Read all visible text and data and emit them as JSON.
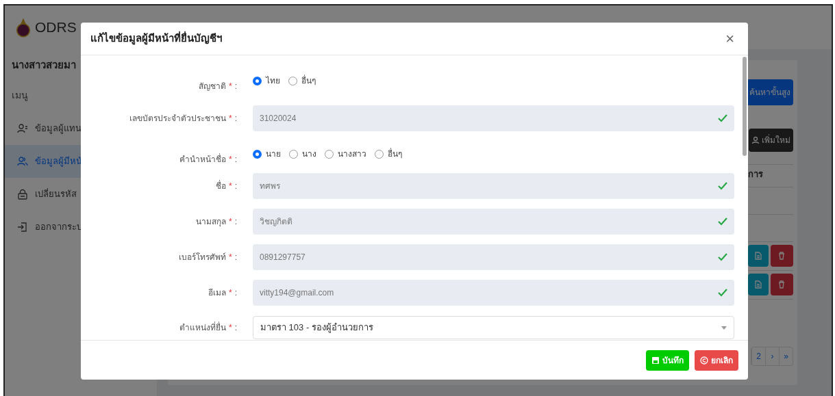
{
  "sidebar": {
    "logo_text": "ODRS",
    "user_name": "นางสาวสวยมา",
    "menu_label": "เมนู",
    "items": [
      {
        "label": "ข้อมูลผู้แทน",
        "kind": "people-list",
        "selected": false
      },
      {
        "label": "ข้อมูลผู้มีหน้",
        "kind": "people",
        "selected": true
      },
      {
        "label": "เปลี่ยนรหัส",
        "kind": "lock",
        "selected": false
      },
      {
        "label": "ออกจากระบ",
        "kind": "logout",
        "selected": false
      }
    ]
  },
  "main": {
    "search_button": "ค้นหาขั้นสูง",
    "add_button": "เพิ่มใหม่",
    "column_header": "การ",
    "pagination": [
      {
        "label": "2",
        "selected": false
      },
      {
        "label": "›",
        "selected": false
      },
      {
        "label": "»",
        "selected": false
      }
    ]
  },
  "modal": {
    "title": "แก้ไขข้อมูลผู้มีหน้าที่ยื่นบัญชีฯ",
    "close": "×",
    "fields": [
      {
        "kind": "radio",
        "label": "สัญชาติ",
        "options": [
          {
            "label": "ไทย",
            "selected": true
          },
          {
            "label": "อื่นๆ",
            "selected": false
          }
        ]
      },
      {
        "kind": "text",
        "label": "เลขบัตรประจำตัวประชาชน",
        "value": "31020024",
        "valid": true,
        "disabled": true
      },
      {
        "kind": "radio",
        "label": "คำนำหน้าชื่อ",
        "options": [
          {
            "label": "นาย",
            "selected": true
          },
          {
            "label": "นาง",
            "selected": false
          },
          {
            "label": "นางสาว",
            "selected": false
          },
          {
            "label": "อื่นๆ",
            "selected": false
          }
        ]
      },
      {
        "kind": "text",
        "label": "ชื่อ",
        "value": "ทศพร",
        "valid": true,
        "disabled": true
      },
      {
        "kind": "text",
        "label": "นามสกุล",
        "value": "วิชญกิตติ",
        "valid": true,
        "disabled": true
      },
      {
        "kind": "text",
        "label": "เบอร์โทรศัพท์",
        "value": "0891297757",
        "valid": true,
        "disabled": true
      },
      {
        "kind": "text",
        "label": "อีเมล",
        "value": "vitty194@gmail.com",
        "valid": true,
        "disabled": true
      },
      {
        "kind": "select",
        "label": "ตำแหน่งที่ยื่น",
        "value": "มาตรา 103 - รองผู้อำนวยการ"
      }
    ],
    "required_mark": "*",
    "colon": ":",
    "buttons": [
      {
        "kind": "save",
        "label": "บันทึก"
      },
      {
        "kind": "cancel",
        "label": "ยกเลิก"
      }
    ]
  }
}
